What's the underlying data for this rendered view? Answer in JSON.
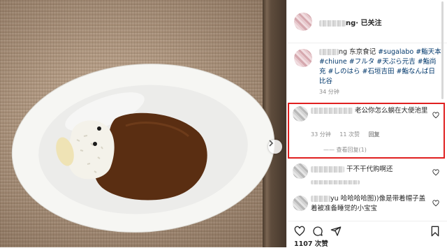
{
  "post": {
    "header": {
      "username_suffix": "ng",
      "follow_status": "· 已关注"
    },
    "caption": {
      "line1_prefix": "ng 东京食记 ",
      "line1_tag": "#sugalabo #鮨天本",
      "line2": "#chiune #フルタ #天ぷら元吉 #鮨尚",
      "line3": "充 #しのはら #石垣吉田 #鮨なんば日",
      "line4": "比谷",
      "time": "34 分钟"
    },
    "comments": [
      {
        "text": "老公你怎么躺在大便池里",
        "time": "33 分钟",
        "likes": "11 次赞",
        "reply_label": "回复",
        "view_replies": "—— 查看回复(1)"
      },
      {
        "text": "干不干代购啊还"
      },
      {
        "text": "哈哈哈哈图))像是带着帽子盖着被准备睡觉的小宝宝",
        "name_fragment": "yu"
      }
    ],
    "likes_count": "1107 次赞"
  },
  "icons": {
    "heart": "heart-icon",
    "comment": "comment-icon",
    "share": "share-icon",
    "bookmark": "bookmark-icon",
    "next": "chevron-right-icon"
  },
  "colors": {
    "hashtag": "#00376b",
    "highlight": "#e02020",
    "muted": "#8e8e8e"
  }
}
